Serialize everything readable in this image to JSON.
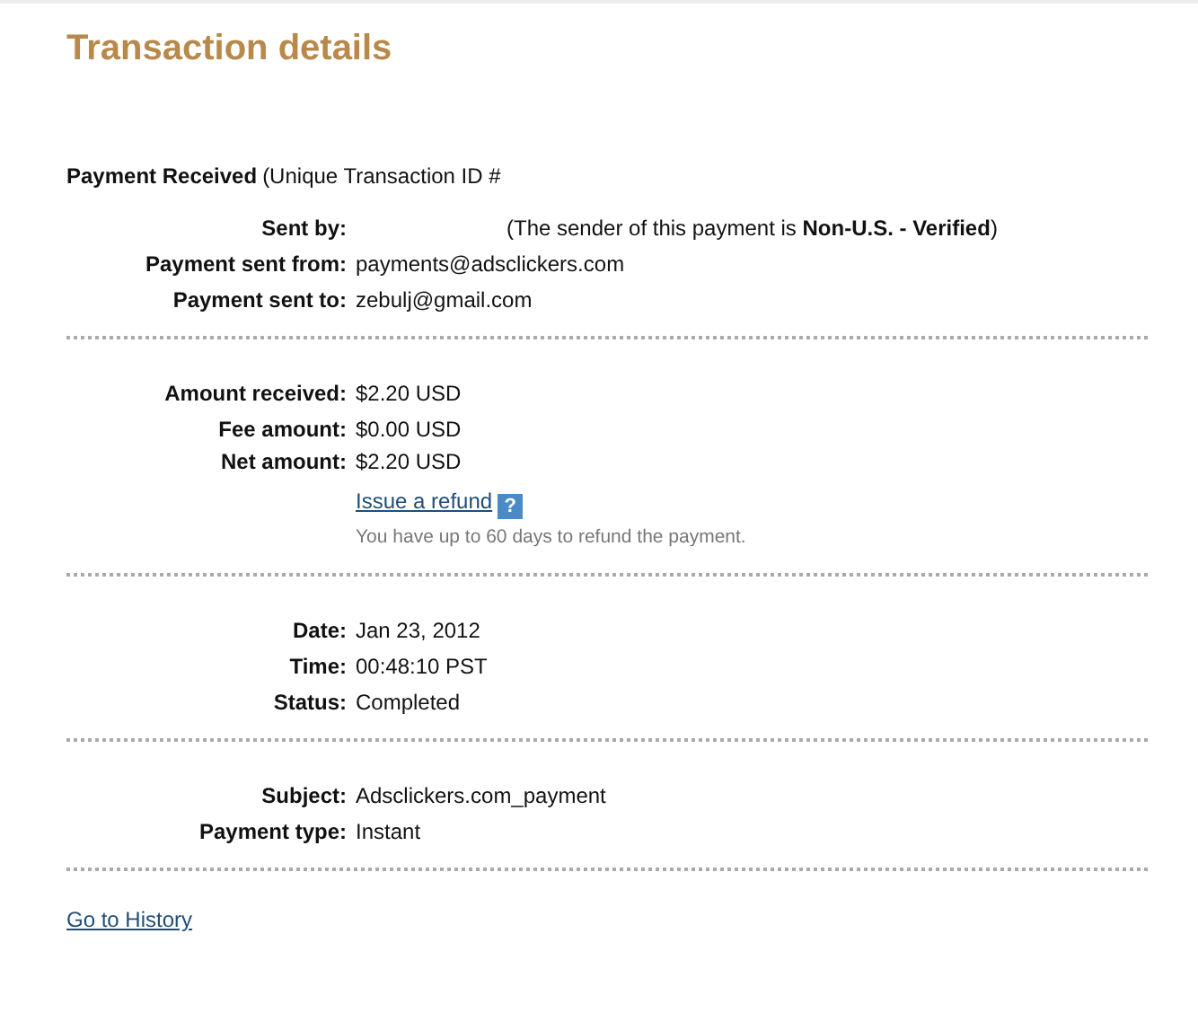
{
  "title": "Transaction details",
  "header": {
    "label": "Payment Received",
    "text": "(Unique Transaction ID #"
  },
  "sections": [
    {
      "rows": [
        {
          "kind": "field",
          "label": "Sent by:",
          "value": "(The sender of this payment is **Non-U.S. - Verified**)",
          "redacted": true
        },
        {
          "kind": "field",
          "label": "Payment sent from:",
          "value": "payments@adsclickers.com"
        },
        {
          "kind": "field",
          "label": "Payment sent to:",
          "value": "zebulj@gmail.com"
        }
      ]
    },
    {
      "rows": [
        {
          "kind": "field",
          "label": "Amount received:",
          "value": "$2.20 USD"
        },
        {
          "kind": "field",
          "label": "Fee amount:",
          "value": "$0.00 USD"
        },
        {
          "kind": "field",
          "label": "Net amount:",
          "value": "$2.20 USD"
        },
        {
          "kind": "link",
          "value": "Issue a refund",
          "help": "?"
        },
        {
          "kind": "note",
          "value": "You have up to 60 days to refund the payment."
        }
      ]
    },
    {
      "rows": [
        {
          "kind": "field",
          "label": "Date:",
          "value": "Jan 23, 2012"
        },
        {
          "kind": "field",
          "label": "Time:",
          "value": "00:48:10 PST"
        },
        {
          "kind": "field",
          "label": "Status:",
          "value": "Completed"
        }
      ]
    },
    {
      "rows": [
        {
          "kind": "field",
          "label": "Subject:",
          "value": "Adsclickers.com_payment"
        },
        {
          "kind": "field",
          "label": "Payment type:",
          "value": "Instant"
        }
      ]
    }
  ],
  "footer_link": "Go to History"
}
